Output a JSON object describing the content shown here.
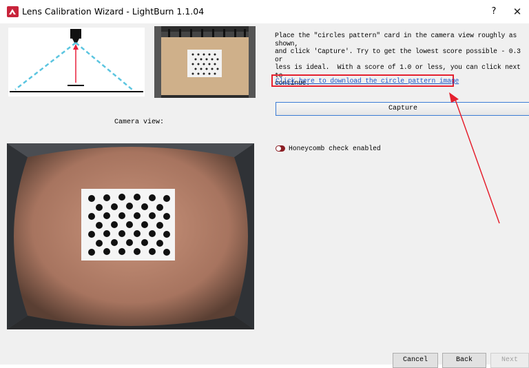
{
  "window": {
    "title": "Lens Calibration Wizard - LightBurn 1.1.04",
    "help_label": "?",
    "close_label": "✕"
  },
  "left_panel": {
    "camera_label": "Camera view:"
  },
  "right_panel": {
    "instructions": "Place the \"circles pattern\" card in the camera view roughly as shown,\nand click 'Capture'. Try to get the lowest score possible - 0.3 or\nless is ideal.  With a score of 1.0 or less, you can click next to\ncontinue.",
    "download_link": "Click here to download the circle pattern image",
    "capture_label": "Capture",
    "honeycomb_label": "Honeycomb check enabled",
    "honeycomb_enabled": false
  },
  "footer": {
    "cancel_label": "Cancel",
    "back_label": "Back",
    "next_label": "Next"
  },
  "colors": {
    "highlight_red": "#e5202e",
    "link_blue": "#1a55c9",
    "toggle_off": "#8b1e24"
  }
}
